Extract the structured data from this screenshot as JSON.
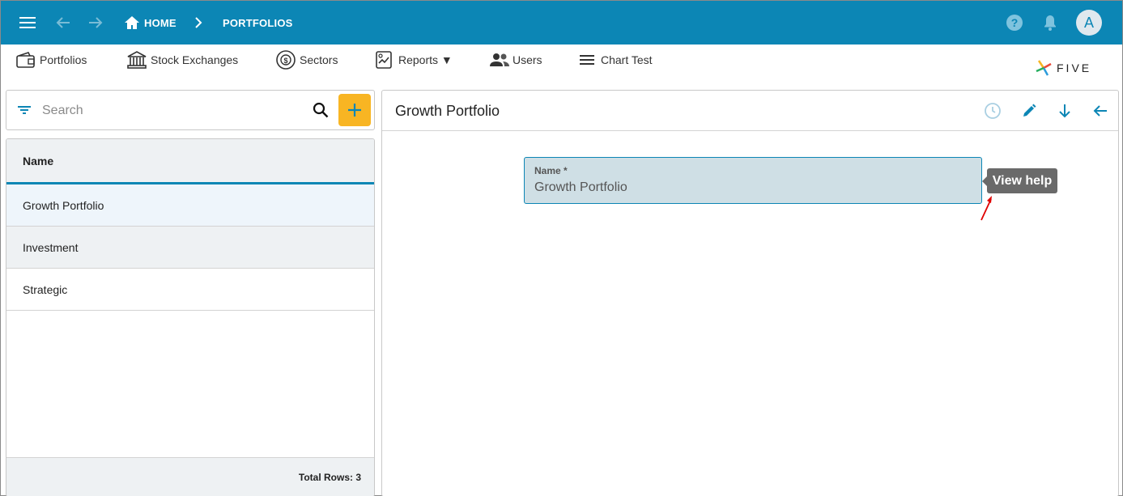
{
  "appbar": {
    "breadcrumb_home": "HOME",
    "breadcrumb_current": "PORTFOLIOS",
    "avatar_letter": "A",
    "color": "#0c86b5"
  },
  "menu": {
    "items": [
      {
        "label": "Portfolios",
        "icon": "wallet-icon"
      },
      {
        "label": "Stock Exchanges",
        "icon": "bank-icon"
      },
      {
        "label": "Sectors",
        "icon": "dollar-cycle-icon"
      },
      {
        "label": "Reports ▼",
        "icon": "report-icon"
      },
      {
        "label": "Users",
        "icon": "users-icon"
      },
      {
        "label": "Chart Test",
        "icon": "lines-icon"
      }
    ],
    "logo_text": "FIVE"
  },
  "search": {
    "placeholder": "Search",
    "add_color": "#f8b523"
  },
  "list": {
    "header": "Name",
    "rows": [
      "Growth Portfolio",
      "Investment",
      "Strategic"
    ],
    "footer": "Total Rows: 3"
  },
  "detail": {
    "title": "Growth Portfolio",
    "field_label": "Name *",
    "field_value": "Growth Portfolio",
    "tooltip": "View help"
  }
}
